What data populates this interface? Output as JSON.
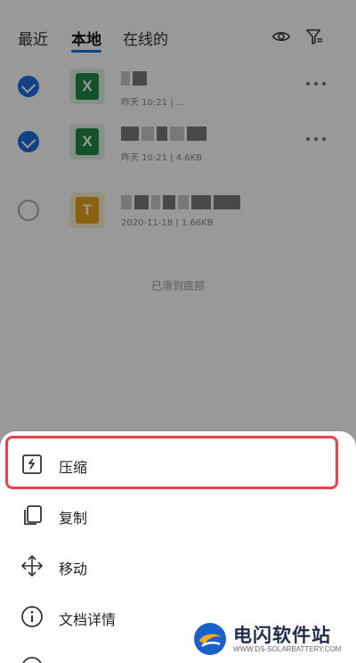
{
  "tabs": {
    "recent": "最近",
    "local": "本地",
    "online": "在线的"
  },
  "icons": {
    "eye": "eye-icon",
    "filter": "filter-icon",
    "more": "more-horizontal-icon",
    "compress": "compress-icon",
    "copy": "copy-icon",
    "move": "move-icon",
    "info": "info-icon"
  },
  "files": [
    {
      "type": "excel",
      "glyph": "X",
      "checked": true,
      "meta": "昨天 10:21 | ..."
    },
    {
      "type": "excel",
      "glyph": "X",
      "checked": true,
      "meta": "昨天 10:21 | 4.6KB"
    },
    {
      "type": "ppt",
      "glyph": "T",
      "checked": false,
      "meta": "2020-11-18 | 1.66KB"
    }
  ],
  "list_end_text": "已滑到底部",
  "menu": {
    "compress": "压缩",
    "copy": "复制",
    "move": "移动",
    "details": "文档详情"
  },
  "watermark": {
    "title": "电闪软件站",
    "url": "WWW.DS-SOLARBATTERY.COM"
  },
  "colors": {
    "accent": "#1a6fe0",
    "highlight": "#e8424b",
    "excel": "#1e8a45",
    "ppt": "#e8a21a"
  }
}
